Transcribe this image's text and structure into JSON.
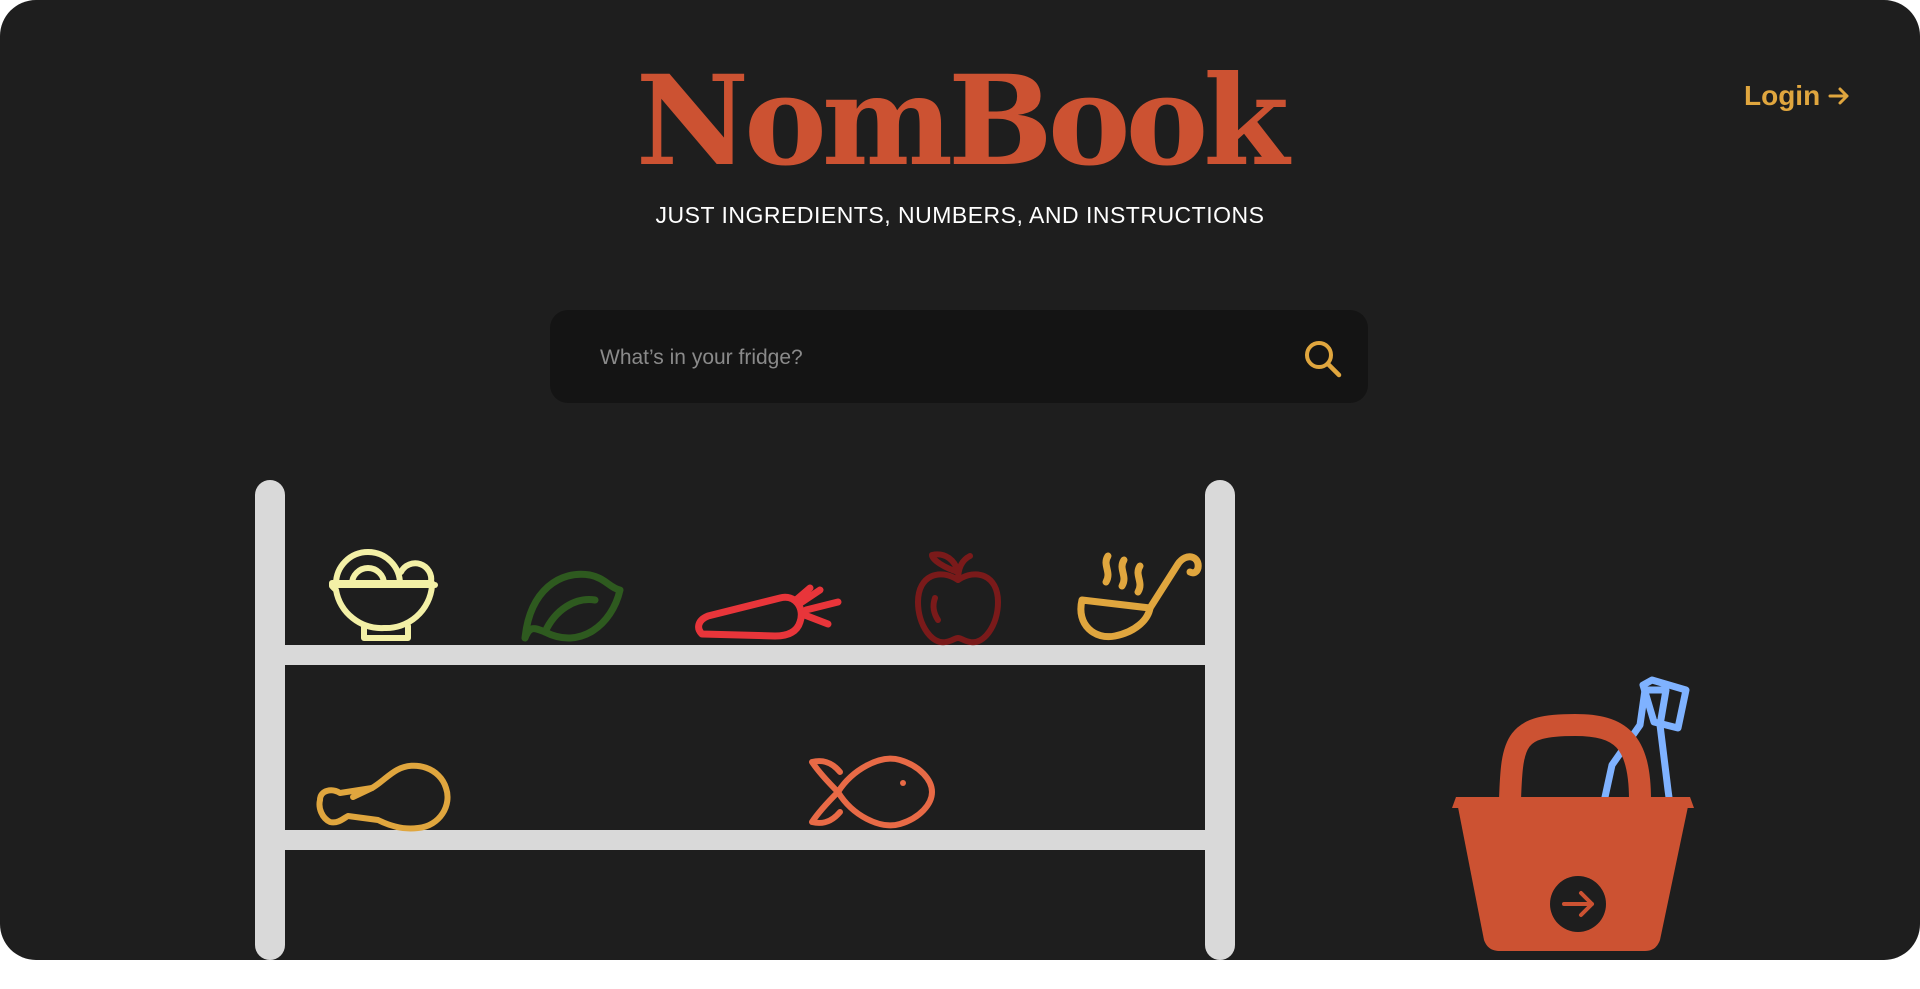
{
  "brand": {
    "title": "NomBook",
    "tagline": "JUST INGREDIENTS, NUMBERS, AND INSTRUCTIONS"
  },
  "header": {
    "login_label": "Login"
  },
  "search": {
    "placeholder": "What’s in your fridge?",
    "icon": "search-icon"
  },
  "shelf": {
    "top_items": [
      "noodle-bowl-icon",
      "leaf-icon",
      "carrot-icon",
      "apple-icon",
      "ladle-icon"
    ],
    "bottom_items": [
      "drumstick-icon",
      "fish-icon"
    ]
  },
  "basket": {
    "icon": "basket-icon",
    "bottle_icon": "bottle-icon",
    "button_icon": "arrow-right-icon"
  },
  "colors": {
    "background": "#1e1e1e",
    "brand": "#cc5232",
    "accent": "#e0a63e",
    "shelf": "#d9d9d9",
    "search_bg": "#141414",
    "noodle": "#f3f0a6",
    "leaf": "#2e5a1f",
    "carrot": "#e8353a",
    "apple": "#7a1a1a",
    "fish": "#e86a46",
    "bottle": "#7fb2ff"
  }
}
